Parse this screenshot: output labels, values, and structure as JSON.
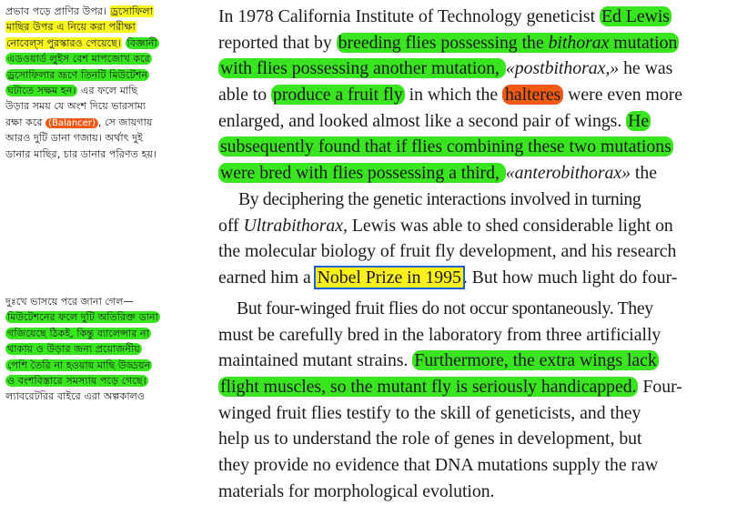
{
  "bengali_top": {
    "l1a": "প্রভাব পড়ে প্রাণির উপর। ",
    "l1b": "ড্রসোফিলা",
    "l2": "মাছির উপর এ নিয়ে করা পরীক্ষা",
    "l3a": "নোবেল্স পুরস্কারও পেয়েছে।",
    "l3b": "বিজ্ঞানী",
    "l4": "এডওয়ার্ড লুইস বেশ মাপজোখ করে",
    "l5": "ড্রসোফিলার ভ্রূণে তিনটি মিউটেশন",
    "l6a": "ঘটাতে সক্ষম হন।",
    "l6b": " এর ফলে মাছি",
    "l7": "উড়ার সময় যে অংশ দিয়ে ভারসাম্য",
    "l8a": "রক্ষা করে ",
    "l8b": "(Balancer)",
    "l8c": ", সে জায়গায়",
    "l9": "আরও দুটি ডানা গজায়। অর্থাৎ দুই",
    "l10": "ডানার মাছির, চার ডানার পরিণত হয়।"
  },
  "bengali_bottom": {
    "l1": "দুঃখে ভাসয়ে পরে জানা গেল—",
    "l2": "মিউটেশনের ফলে দুটি অতিরিক্ত ডানা",
    "l3": "গজিয়েছে ঠিকই, কিন্তু ব্যালেন্সার না",
    "l4": "থাকায় ও উড়ার জন্য প্রয়োজনীয়",
    "l5": "পেশি তৈরি না হওয়ায় মাছি উড্ডয়ন",
    "l6": "ও বংশবিস্তারে সমস্যায় পড়ে গেছে।",
    "l7": "ল্যাবরেটরির বাইরে এরা অল্পকালও"
  },
  "english_top": {
    "l1a": "In 1978 California Institute of Technology geneticist ",
    "l1b": "Ed Lewis",
    "l2a": "reported that by ",
    "l2b": "breeding flies possessing the ",
    "l2c": "bithorax",
    "l2d": " mutation",
    "l3a": "with flies possessing another mutation, ",
    "l3b": "«postbithorax,»",
    "l3c": " he was",
    "l4a": "able to ",
    "l4b": "produce a fruit fly",
    "l4c": " in which the ",
    "l4d": "halteres",
    "l4e": " were even more",
    "l5a": "enlarged, and looked almost like a second pair of wings. ",
    "l5b": "He",
    "l6": "subsequently found that if flies combining these two mutations",
    "l7a": "were bred with flies possessing a third, ",
    "l7b": "«anterobithorax»",
    "l7c": " the",
    "l8": "By deciphering the genetic interactions involved in turning",
    "l9a": "off ",
    "l9b": "Ultrabithorax",
    "l9c": ", Lewis was able to shed considerable light on",
    "l10": "the molecular biology of fruit fly development, and his research",
    "l11a": "earned him a ",
    "l11b": "Nobel Prize in 1995",
    "l11c": ". But how much light do four-"
  },
  "english_bottom": {
    "l1": "But four-winged fruit flies do not occur spontaneously. They",
    "l2": "must be carefully bred in the laboratory from three artificially",
    "l3a": "maintained mutant strains. ",
    "l3b": "Furthermore, the extra wings lack",
    "l4a": "flight muscles, so the mutant fly is seriously handicapped.",
    "l4b": " Four-",
    "l5": "winged fruit flies testify to the skill of geneticists, and they",
    "l6": "help us to understand the role of genes in development, but",
    "l7": "they provide no evidence that DNA mutations supply the raw",
    "l8": "materials for morphological evolution."
  },
  "highlight_colors": {
    "green": "#39e51f",
    "yellow": "#f6f51e",
    "orange": "#f05a16",
    "box_border": "#1f5fd6"
  }
}
